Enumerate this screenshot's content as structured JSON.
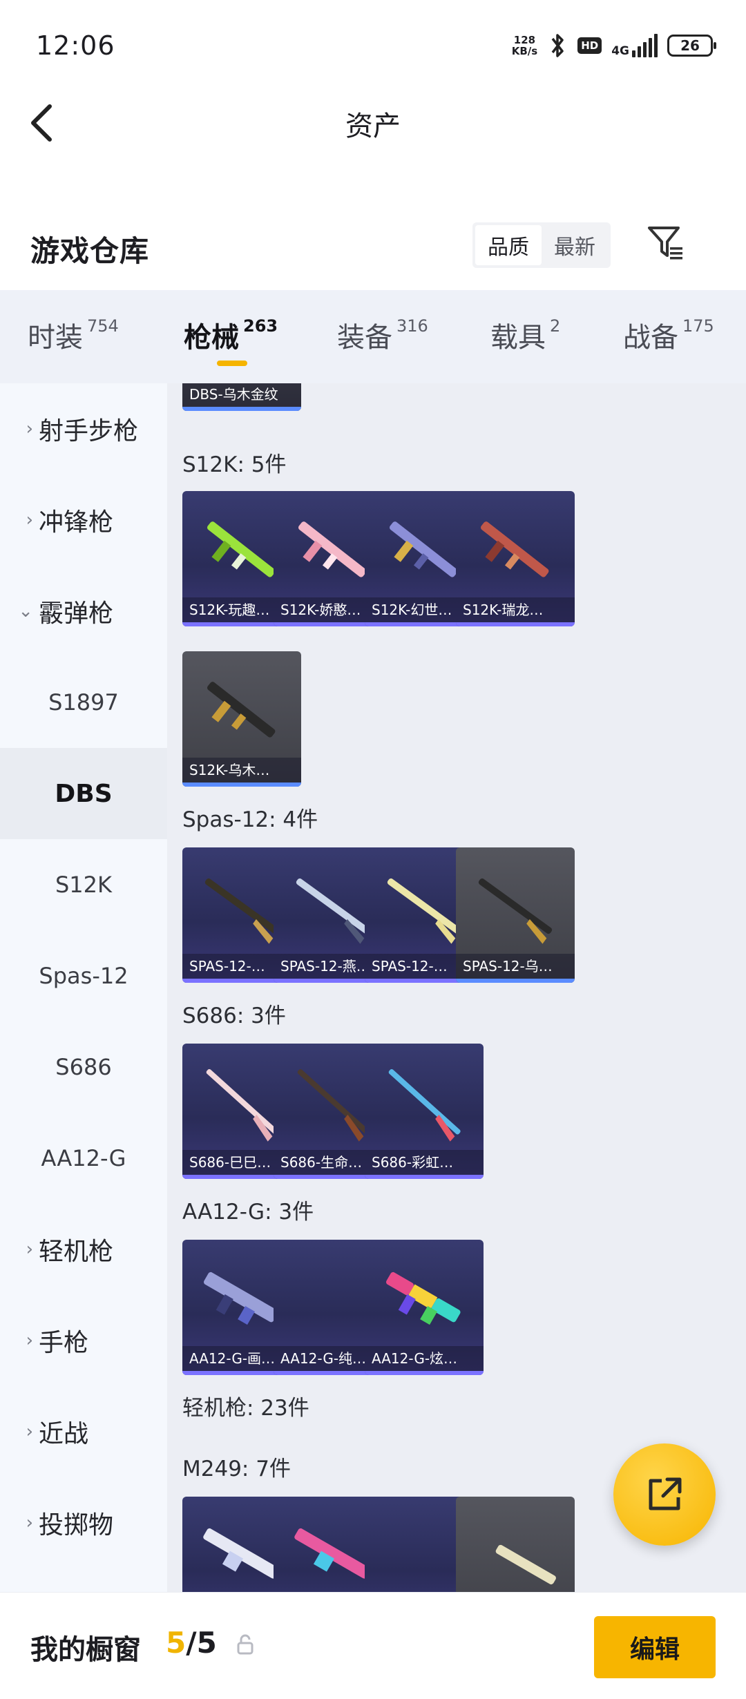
{
  "status_bar": {
    "time": "12:06",
    "net_speed_value": "128",
    "net_speed_unit": "KB/s",
    "hd": "HD",
    "network": "4G",
    "battery": "26"
  },
  "nav": {
    "title": "资产"
  },
  "header": {
    "title": "游戏仓库",
    "sort_quality": "品质",
    "sort_latest": "最新"
  },
  "category_tabs": [
    {
      "label": "时装",
      "count": "754"
    },
    {
      "label": "枪械",
      "count": "263"
    },
    {
      "label": "装备",
      "count": "316"
    },
    {
      "label": "载具",
      "count": "2"
    },
    {
      "label": "战备",
      "count": "175"
    }
  ],
  "sidebar": {
    "items": [
      {
        "label": "射手步枪"
      },
      {
        "label": "冲锋枪"
      },
      {
        "label": "霰弹枪"
      },
      {
        "label": "S1897"
      },
      {
        "label": "DBS"
      },
      {
        "label": "S12K"
      },
      {
        "label": "Spas-12"
      },
      {
        "label": "S686"
      },
      {
        "label": "AA12-G"
      },
      {
        "label": "轻机枪"
      },
      {
        "label": "手枪"
      },
      {
        "label": "近战"
      },
      {
        "label": "投掷物"
      }
    ]
  },
  "grid": {
    "top_card": "DBS-乌木金纹",
    "groups": [
      {
        "label": "S12K: 5件",
        "items": [
          "S12K-玩趣…",
          "S12K-娇憨…",
          "S12K-幻世…",
          "S12K-瑞龙…",
          "S12K-乌木…"
        ]
      },
      {
        "label": "Spas-12: 4件",
        "items": [
          "SPAS-12-…",
          "SPAS-12-燕…",
          "SPAS-12-…",
          "SPAS-12-乌…"
        ]
      },
      {
        "label": "S686: 3件",
        "items": [
          "S686-巳巳…",
          "S686-生命…",
          "S686-彩虹…"
        ]
      },
      {
        "label": "AA12-G: 3件",
        "items": [
          "AA12-G-画…",
          "AA12-G-纯…",
          "AA12-G-炫…"
        ]
      }
    ],
    "category_label": "轻机枪: 23件",
    "m249_label": "M249: 7件"
  },
  "bottom": {
    "showcase_label": "我的橱窗",
    "current": "5",
    "total": "/5",
    "edit": "编辑"
  },
  "colors": {
    "accent": "#f7b500",
    "card_bg": "#2d2f5e",
    "rarity_purple": "#7b72ff"
  }
}
